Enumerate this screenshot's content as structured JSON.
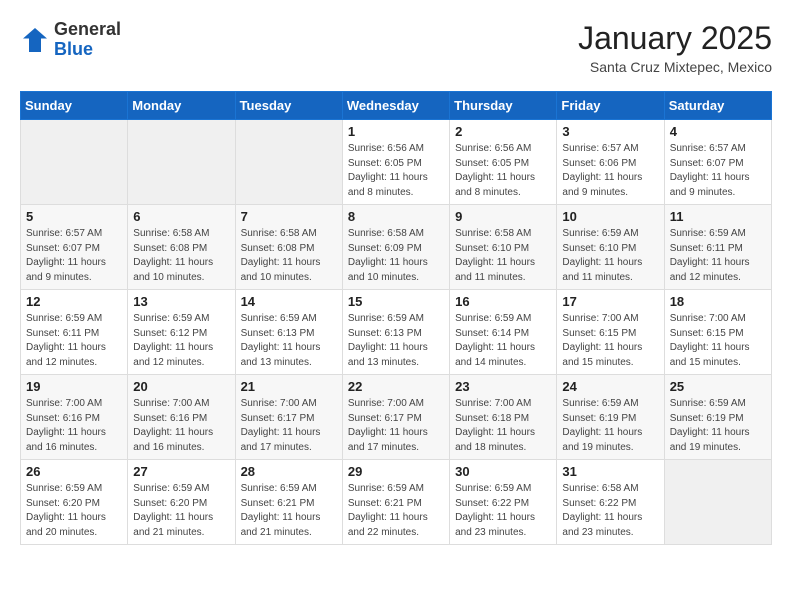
{
  "header": {
    "logo_general": "General",
    "logo_blue": "Blue",
    "month_title": "January 2025",
    "location": "Santa Cruz Mixtepec, Mexico"
  },
  "weekdays": [
    "Sunday",
    "Monday",
    "Tuesday",
    "Wednesday",
    "Thursday",
    "Friday",
    "Saturday"
  ],
  "weeks": [
    [
      {
        "day": "",
        "info": ""
      },
      {
        "day": "",
        "info": ""
      },
      {
        "day": "",
        "info": ""
      },
      {
        "day": "1",
        "info": "Sunrise: 6:56 AM\nSunset: 6:05 PM\nDaylight: 11 hours\nand 8 minutes."
      },
      {
        "day": "2",
        "info": "Sunrise: 6:56 AM\nSunset: 6:05 PM\nDaylight: 11 hours\nand 8 minutes."
      },
      {
        "day": "3",
        "info": "Sunrise: 6:57 AM\nSunset: 6:06 PM\nDaylight: 11 hours\nand 9 minutes."
      },
      {
        "day": "4",
        "info": "Sunrise: 6:57 AM\nSunset: 6:07 PM\nDaylight: 11 hours\nand 9 minutes."
      }
    ],
    [
      {
        "day": "5",
        "info": "Sunrise: 6:57 AM\nSunset: 6:07 PM\nDaylight: 11 hours\nand 9 minutes."
      },
      {
        "day": "6",
        "info": "Sunrise: 6:58 AM\nSunset: 6:08 PM\nDaylight: 11 hours\nand 10 minutes."
      },
      {
        "day": "7",
        "info": "Sunrise: 6:58 AM\nSunset: 6:08 PM\nDaylight: 11 hours\nand 10 minutes."
      },
      {
        "day": "8",
        "info": "Sunrise: 6:58 AM\nSunset: 6:09 PM\nDaylight: 11 hours\nand 10 minutes."
      },
      {
        "day": "9",
        "info": "Sunrise: 6:58 AM\nSunset: 6:10 PM\nDaylight: 11 hours\nand 11 minutes."
      },
      {
        "day": "10",
        "info": "Sunrise: 6:59 AM\nSunset: 6:10 PM\nDaylight: 11 hours\nand 11 minutes."
      },
      {
        "day": "11",
        "info": "Sunrise: 6:59 AM\nSunset: 6:11 PM\nDaylight: 11 hours\nand 12 minutes."
      }
    ],
    [
      {
        "day": "12",
        "info": "Sunrise: 6:59 AM\nSunset: 6:11 PM\nDaylight: 11 hours\nand 12 minutes."
      },
      {
        "day": "13",
        "info": "Sunrise: 6:59 AM\nSunset: 6:12 PM\nDaylight: 11 hours\nand 12 minutes."
      },
      {
        "day": "14",
        "info": "Sunrise: 6:59 AM\nSunset: 6:13 PM\nDaylight: 11 hours\nand 13 minutes."
      },
      {
        "day": "15",
        "info": "Sunrise: 6:59 AM\nSunset: 6:13 PM\nDaylight: 11 hours\nand 13 minutes."
      },
      {
        "day": "16",
        "info": "Sunrise: 6:59 AM\nSunset: 6:14 PM\nDaylight: 11 hours\nand 14 minutes."
      },
      {
        "day": "17",
        "info": "Sunrise: 7:00 AM\nSunset: 6:15 PM\nDaylight: 11 hours\nand 15 minutes."
      },
      {
        "day": "18",
        "info": "Sunrise: 7:00 AM\nSunset: 6:15 PM\nDaylight: 11 hours\nand 15 minutes."
      }
    ],
    [
      {
        "day": "19",
        "info": "Sunrise: 7:00 AM\nSunset: 6:16 PM\nDaylight: 11 hours\nand 16 minutes."
      },
      {
        "day": "20",
        "info": "Sunrise: 7:00 AM\nSunset: 6:16 PM\nDaylight: 11 hours\nand 16 minutes."
      },
      {
        "day": "21",
        "info": "Sunrise: 7:00 AM\nSunset: 6:17 PM\nDaylight: 11 hours\nand 17 minutes."
      },
      {
        "day": "22",
        "info": "Sunrise: 7:00 AM\nSunset: 6:17 PM\nDaylight: 11 hours\nand 17 minutes."
      },
      {
        "day": "23",
        "info": "Sunrise: 7:00 AM\nSunset: 6:18 PM\nDaylight: 11 hours\nand 18 minutes."
      },
      {
        "day": "24",
        "info": "Sunrise: 6:59 AM\nSunset: 6:19 PM\nDaylight: 11 hours\nand 19 minutes."
      },
      {
        "day": "25",
        "info": "Sunrise: 6:59 AM\nSunset: 6:19 PM\nDaylight: 11 hours\nand 19 minutes."
      }
    ],
    [
      {
        "day": "26",
        "info": "Sunrise: 6:59 AM\nSunset: 6:20 PM\nDaylight: 11 hours\nand 20 minutes."
      },
      {
        "day": "27",
        "info": "Sunrise: 6:59 AM\nSunset: 6:20 PM\nDaylight: 11 hours\nand 21 minutes."
      },
      {
        "day": "28",
        "info": "Sunrise: 6:59 AM\nSunset: 6:21 PM\nDaylight: 11 hours\nand 21 minutes."
      },
      {
        "day": "29",
        "info": "Sunrise: 6:59 AM\nSunset: 6:21 PM\nDaylight: 11 hours\nand 22 minutes."
      },
      {
        "day": "30",
        "info": "Sunrise: 6:59 AM\nSunset: 6:22 PM\nDaylight: 11 hours\nand 23 minutes."
      },
      {
        "day": "31",
        "info": "Sunrise: 6:58 AM\nSunset: 6:22 PM\nDaylight: 11 hours\nand 23 minutes."
      },
      {
        "day": "",
        "info": ""
      }
    ]
  ]
}
